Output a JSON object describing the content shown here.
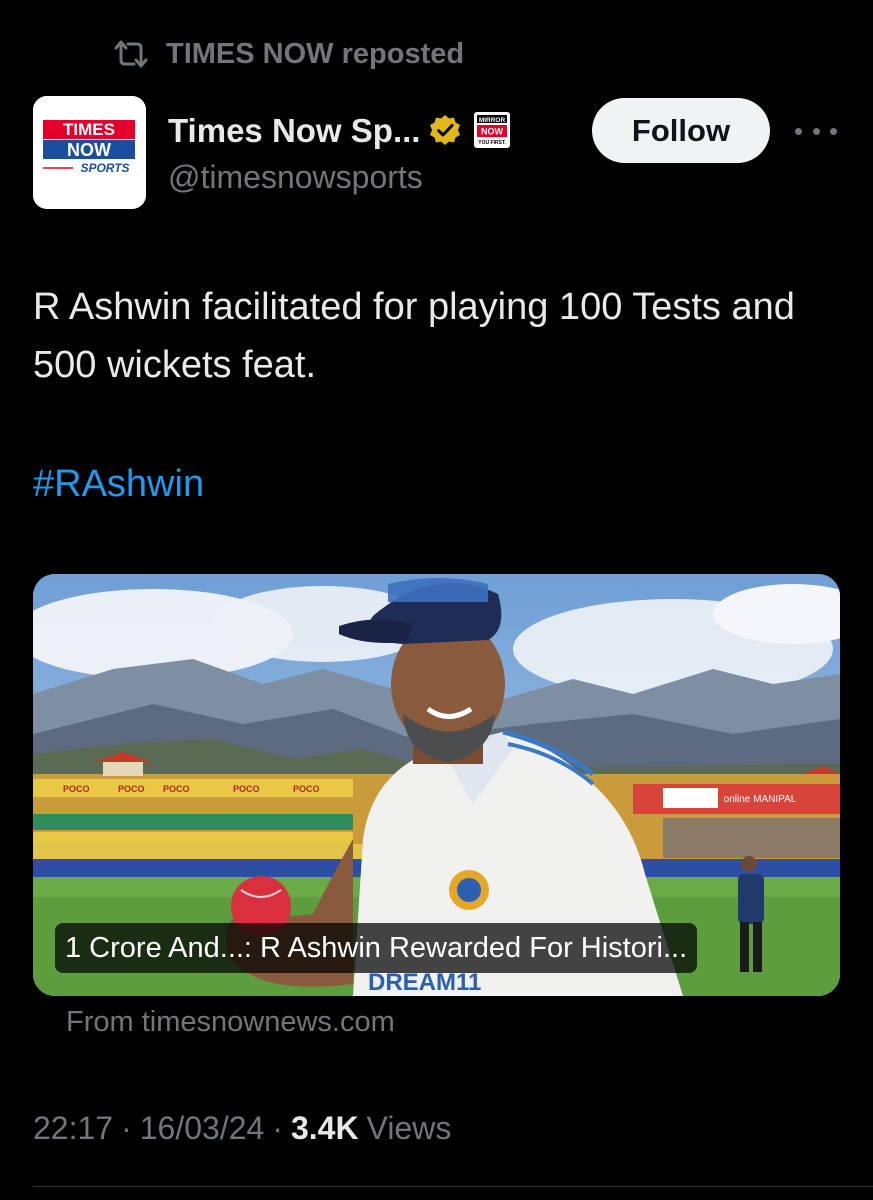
{
  "repost": {
    "icon": "repost-icon",
    "label": "TIMES NOW reposted"
  },
  "author": {
    "avatar_icon": "times-now-sports-logo",
    "avatar_text": {
      "line1": "TIMES",
      "line2": "NOW",
      "line3": "SPORTS"
    },
    "display_name": "Times Now Sp...",
    "verified_icon": "gold-verified-badge-icon",
    "affiliate_badge": {
      "icon": "mirror-now-affiliate-badge",
      "line1": "MIRROR",
      "line2": "NOW",
      "line3": "YOU FIRST."
    },
    "handle": "@timesnowsports"
  },
  "actions": {
    "follow_label": "Follow",
    "more_icon": "more-options-icon"
  },
  "tweet": {
    "text": "R Ashwin facilitated for playing 100 Tests and 500 wickets feat.",
    "hashtag": "#RAshwin"
  },
  "link_card": {
    "title": "1 Crore And...: R Ashwin Rewarded For Histori...",
    "source": "From timesnownews.com",
    "banner_texts": {
      "poco": "POCO",
      "online_manipal": "online MANIPAL",
      "jersey": "DREAM11"
    }
  },
  "meta": {
    "time": "22:17",
    "separator": "·",
    "date": "16/03/24",
    "views_count": "3.4K",
    "views_label": "Views"
  },
  "colors": {
    "background": "#000000",
    "text_primary": "#e7e9ea",
    "text_secondary": "#71767b",
    "link_blue": "#1d9bf0",
    "follow_button_bg": "#eff3f4",
    "verified_gold": "#e2b719",
    "times_red": "#e4002b",
    "times_blue": "#1a4fa0"
  }
}
